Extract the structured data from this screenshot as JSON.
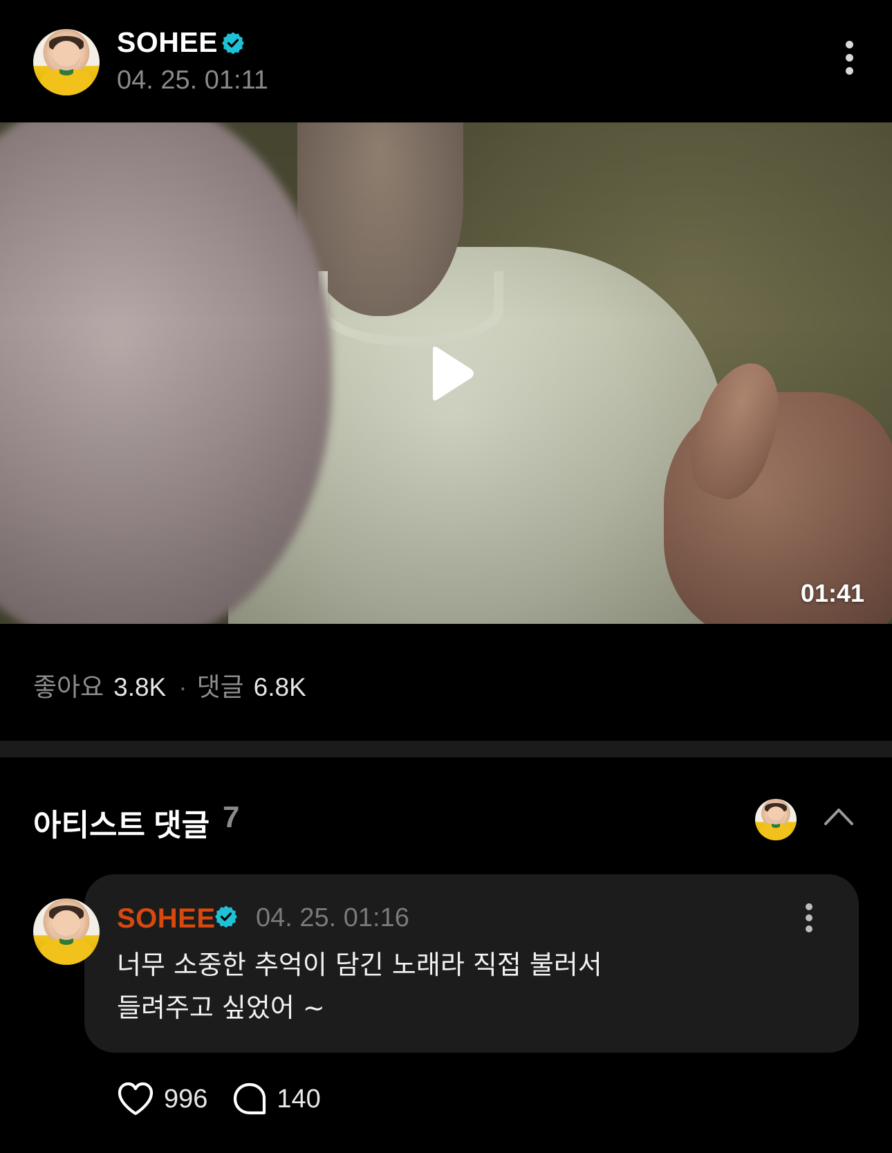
{
  "post": {
    "author": "SOHEE",
    "timestamp": "04. 25. 01:11",
    "verified_color": "#1fc1d6"
  },
  "video": {
    "duration": "01:41",
    "play_icon": "play-icon"
  },
  "stats": {
    "likes_label": "좋아요",
    "likes_count": "3.8K",
    "separator": "·",
    "comments_label": "댓글",
    "comments_count": "6.8K"
  },
  "artist_comments": {
    "title": "아티스트 댓글",
    "count": "7",
    "collapse_icon": "chevron-up-icon",
    "comment": {
      "author": "SOHEE",
      "author_color": "#d8490f",
      "timestamp": "04. 25. 01:16",
      "text_lines": [
        "너무 소중한 추억이 담긴 노래라 직접 불러서",
        "들려주고 싶었어 ~"
      ],
      "likes": "996",
      "replies": "140",
      "like_icon": "heart-icon",
      "reply_icon": "speech-bubble-icon"
    }
  }
}
